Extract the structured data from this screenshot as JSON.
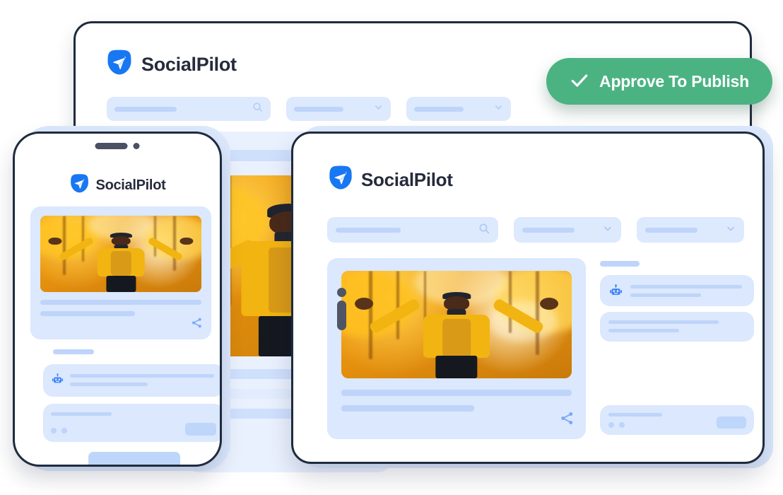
{
  "brand": {
    "name": "SocialPilot",
    "logo_icon": "paper-plane-icon",
    "logo_color": "#1877f2",
    "text_color": "#262b3c"
  },
  "cta": {
    "label": "Approve To Publish",
    "icon": "check-icon",
    "color": "#4bb382",
    "text_color": "#ffffff"
  },
  "top_panel": {
    "brand_name": "SocialPilot",
    "filters": [
      {
        "name": "search-field",
        "placeholder": "",
        "icon": "search-icon"
      },
      {
        "name": "filter-dropdown-1",
        "value": "",
        "icon": "chevron-down-icon"
      },
      {
        "name": "filter-dropdown-2",
        "value": "",
        "icon": "chevron-down-icon"
      }
    ]
  },
  "mobile_panel": {
    "brand_name": "SocialPilot",
    "notch": {
      "speaker": "speaker-pill",
      "camera": "camera-dot"
    },
    "post": {
      "image_alt": "man in yellow jacket with arms raised among autumn foliage",
      "caption_lines": 2,
      "share_icon": "share-icon"
    },
    "section_label": "",
    "ai_card": {
      "icon": "robot-icon",
      "lines": 2
    },
    "info_card": {
      "lines": 1,
      "dots": 2
    },
    "cta_button": {
      "label": "",
      "color": "#bfd6fb"
    }
  },
  "main_panel": {
    "brand_name": "SocialPilot",
    "filters": [
      {
        "name": "search-field",
        "placeholder": "",
        "icon": "search-icon"
      },
      {
        "name": "filter-dropdown-1",
        "value": "",
        "icon": "chevron-down-icon"
      },
      {
        "name": "filter-dropdown-2",
        "value": "",
        "icon": "chevron-down-icon"
      }
    ],
    "post": {
      "image_alt": "man in yellow jacket with arms raised among autumn foliage",
      "caption_lines": 2,
      "share_icon": "share-icon",
      "cursor_icon": "text-cursor-icon"
    },
    "sidebar": {
      "section_label": "",
      "ai_card": {
        "icon": "robot-icon",
        "lines": 2
      },
      "detail_card": {
        "lines": 2
      },
      "footer_card": {
        "lines": 1,
        "dots": 2,
        "button_label": ""
      }
    }
  },
  "back_panel": {
    "image_alt": "enlarged preview of the same autumn photo",
    "bars": 3
  },
  "palette": {
    "panel_border": "#1f2b3e",
    "skeleton_bg": "#dbe8fd",
    "skeleton_bar": "#bed4fa",
    "field_bg": "#dde9fd",
    "backdrop_blue": "#eaf1fe",
    "accent_blue": "#3b82f6",
    "photo_yellow": "#f2b411"
  }
}
